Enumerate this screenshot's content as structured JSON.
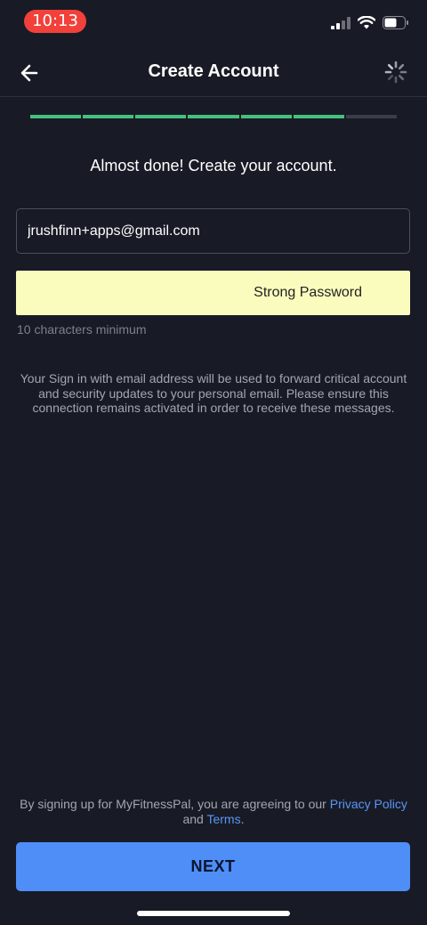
{
  "status_bar": {
    "time": "10:13"
  },
  "nav": {
    "title": "Create Account"
  },
  "progress": {
    "total_steps": 7,
    "completed_steps": 6
  },
  "heading": "Almost done! Create your account.",
  "email": {
    "value": "jrushfinn+apps@gmail.com"
  },
  "password": {
    "strength_label": "Strong Password"
  },
  "password_hint": "10 characters minimum",
  "notice": "Your Sign in with email address will be used to forward critical account and security updates to your personal email. Please ensure this connection remains activated in order to receive these messages.",
  "legal": {
    "prefix": "By signing up for MyFitnessPal, you are agreeing to our ",
    "privacy_label": "Privacy Policy",
    "and": " and ",
    "terms_label": "Terms",
    "suffix": "."
  },
  "next_label": "NEXT",
  "colors": {
    "accent": "#4f8ef7",
    "progress_done": "#46c07f",
    "password_bg": "#fafcbd",
    "time_pill": "#f2403a"
  }
}
